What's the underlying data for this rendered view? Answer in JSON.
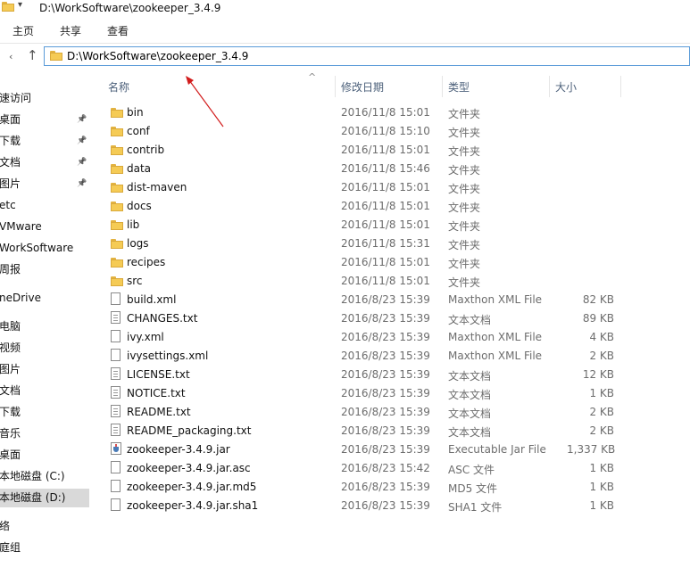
{
  "window": {
    "title": "D:\\WorkSoftware\\zookeeper_3.4.9",
    "qat_arrow": "▾"
  },
  "ribbon": {
    "tabs": [
      {
        "label": "主页"
      },
      {
        "label": "共享"
      },
      {
        "label": "查看"
      }
    ]
  },
  "nav": {
    "back": "‹",
    "up": "↑",
    "address": "D:\\WorkSoftware\\zookeeper_3.4.9"
  },
  "sidebar": {
    "items": [
      {
        "label": "速访问"
      },
      {
        "label": "桌面",
        "pinned": true
      },
      {
        "label": "下载",
        "pinned": true
      },
      {
        "label": "文档",
        "pinned": true
      },
      {
        "label": "图片",
        "pinned": true
      },
      {
        "label": "etc"
      },
      {
        "label": "VMware"
      },
      {
        "label": "WorkSoftware"
      },
      {
        "label": "周报"
      },
      {
        "label": "neDrive"
      },
      {
        "label": "电脑"
      },
      {
        "label": "视频"
      },
      {
        "label": "图片"
      },
      {
        "label": "文档"
      },
      {
        "label": "下载"
      },
      {
        "label": "音乐"
      },
      {
        "label": "桌面"
      },
      {
        "label": "本地磁盘 (C:)"
      },
      {
        "label": "本地磁盘 (D:)",
        "selected": true
      },
      {
        "label": "络"
      },
      {
        "label": "庭组"
      }
    ],
    "pin_glyph": "📌"
  },
  "columns": {
    "name": "名称",
    "modified": "修改日期",
    "type": "类型",
    "size": "大小",
    "sort_glyph": "^"
  },
  "files": [
    {
      "name": "bin",
      "date": "2016/11/8 15:01",
      "type": "文件夹",
      "size": "",
      "icon": "folder"
    },
    {
      "name": "conf",
      "date": "2016/11/8 15:10",
      "type": "文件夹",
      "size": "",
      "icon": "folder"
    },
    {
      "name": "contrib",
      "date": "2016/11/8 15:01",
      "type": "文件夹",
      "size": "",
      "icon": "folder"
    },
    {
      "name": "data",
      "date": "2016/11/8 15:46",
      "type": "文件夹",
      "size": "",
      "icon": "folder"
    },
    {
      "name": "dist-maven",
      "date": "2016/11/8 15:01",
      "type": "文件夹",
      "size": "",
      "icon": "folder"
    },
    {
      "name": "docs",
      "date": "2016/11/8 15:01",
      "type": "文件夹",
      "size": "",
      "icon": "folder"
    },
    {
      "name": "lib",
      "date": "2016/11/8 15:01",
      "type": "文件夹",
      "size": "",
      "icon": "folder"
    },
    {
      "name": "logs",
      "date": "2016/11/8 15:31",
      "type": "文件夹",
      "size": "",
      "icon": "folder"
    },
    {
      "name": "recipes",
      "date": "2016/11/8 15:01",
      "type": "文件夹",
      "size": "",
      "icon": "folder"
    },
    {
      "name": "src",
      "date": "2016/11/8 15:01",
      "type": "文件夹",
      "size": "",
      "icon": "folder"
    },
    {
      "name": "build.xml",
      "date": "2016/8/23 15:39",
      "type": "Maxthon XML File",
      "size": "82 KB",
      "icon": "xml"
    },
    {
      "name": "CHANGES.txt",
      "date": "2016/8/23 15:39",
      "type": "文本文档",
      "size": "89 KB",
      "icon": "text"
    },
    {
      "name": "ivy.xml",
      "date": "2016/8/23 15:39",
      "type": "Maxthon XML File",
      "size": "4 KB",
      "icon": "xml"
    },
    {
      "name": "ivysettings.xml",
      "date": "2016/8/23 15:39",
      "type": "Maxthon XML File",
      "size": "2 KB",
      "icon": "xml"
    },
    {
      "name": "LICENSE.txt",
      "date": "2016/8/23 15:39",
      "type": "文本文档",
      "size": "12 KB",
      "icon": "text"
    },
    {
      "name": "NOTICE.txt",
      "date": "2016/8/23 15:39",
      "type": "文本文档",
      "size": "1 KB",
      "icon": "text"
    },
    {
      "name": "README.txt",
      "date": "2016/8/23 15:39",
      "type": "文本文档",
      "size": "2 KB",
      "icon": "text"
    },
    {
      "name": "README_packaging.txt",
      "date": "2016/8/23 15:39",
      "type": "文本文档",
      "size": "2 KB",
      "icon": "text"
    },
    {
      "name": "zookeeper-3.4.9.jar",
      "date": "2016/8/23 15:39",
      "type": "Executable Jar File",
      "size": "1,337 KB",
      "icon": "jar"
    },
    {
      "name": "zookeeper-3.4.9.jar.asc",
      "date": "2016/8/23 15:42",
      "type": "ASC 文件",
      "size": "1 KB",
      "icon": "file"
    },
    {
      "name": "zookeeper-3.4.9.jar.md5",
      "date": "2016/8/23 15:39",
      "type": "MD5 文件",
      "size": "1 KB",
      "icon": "file"
    },
    {
      "name": "zookeeper-3.4.9.jar.sha1",
      "date": "2016/8/23 15:39",
      "type": "SHA1 文件",
      "size": "1 KB",
      "icon": "file"
    }
  ],
  "colors": {
    "accent": "#5a9bd8",
    "folder": "#f5cb55",
    "annotation": "#d21c1c",
    "selected": "#d9d9d9"
  }
}
